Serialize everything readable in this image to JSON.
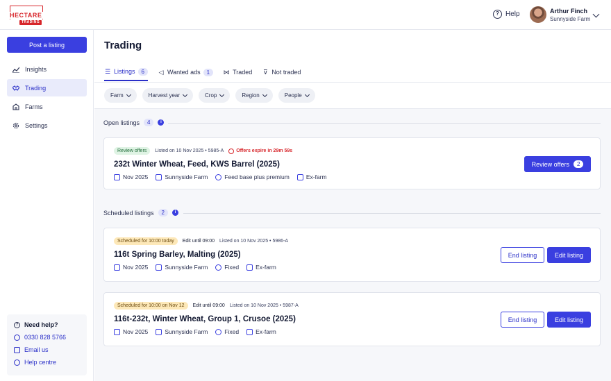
{
  "brand": {
    "name": "HECTARE",
    "sub": "TRADING",
    "color": "#d7262b"
  },
  "header": {
    "help_label": "Help",
    "user_name": "Arthur Finch",
    "user_farm": "Sunnyside Farm"
  },
  "sidebar": {
    "post_button": "Post a listing",
    "items": [
      {
        "label": "Insights",
        "icon": "chart-line-icon"
      },
      {
        "label": "Trading",
        "icon": "handshake-icon"
      },
      {
        "label": "Farms",
        "icon": "farm-icon"
      },
      {
        "label": "Settings",
        "icon": "gear-icon"
      }
    ],
    "help": {
      "title": "Need help?",
      "phone": "0330 828 5766",
      "email": "Email us",
      "centre": "Help centre"
    }
  },
  "page": {
    "title": "Trading",
    "tabs": [
      {
        "label": "Listings",
        "count": "6",
        "icon": "list-icon"
      },
      {
        "label": "Wanted ads",
        "count": "1",
        "icon": "megaphone-icon"
      },
      {
        "label": "Traded",
        "icon": "handshake-icon"
      },
      {
        "label": "Not traded",
        "icon": "thumbs-down-icon"
      }
    ],
    "filters": [
      "Farm",
      "Harvest year",
      "Crop",
      "Region",
      "People"
    ]
  },
  "open_section": {
    "label": "Open listings",
    "count": "4",
    "cards": [
      {
        "status": "Review offers",
        "meta": "Listed on 10 Nov 2025 • 5985-A",
        "expire": "Offers expire in 29m 59s",
        "title": "232t Winter Wheat, Feed, KWS Barrel (2025)",
        "date": "Nov 2025",
        "farm": "Sunnyside Farm",
        "price": "Feed base plus premium",
        "delivery": "Ex-farm",
        "button": "Review offers",
        "button_count": "2"
      }
    ]
  },
  "scheduled_section": {
    "label": "Scheduled listings",
    "count": "2",
    "cards": [
      {
        "status": "Scheduled for 10:00 today",
        "edit_until": "Edit until 09:00",
        "meta": "Listed on 10 Nov 2025 • 5986-A",
        "title": "116t Spring Barley, Malting (2025)",
        "date": "Nov 2025",
        "farm": "Sunnyside Farm",
        "price": "Fixed",
        "delivery": "Ex-farm",
        "end_button": "End listing",
        "edit_button": "Edit listing"
      },
      {
        "status": "Scheduled for 10:00 on Nov 12",
        "edit_until": "Edit until 09:00",
        "meta": "Listed on 10 Nov 2025 • 5987-A",
        "title": "116t-232t, Winter Wheat, Group 1, Crusoe (2025)",
        "date": "Nov 2025",
        "farm": "Sunnyside Farm",
        "price": "Fixed",
        "delivery": "Ex-farm",
        "end_button": "End listing",
        "edit_button": "Edit listing"
      }
    ]
  },
  "colors": {
    "accent": "#3a3fe0",
    "expire": "#d7262b",
    "scheduled": "#fde8b8",
    "open": "#dff3e4"
  }
}
